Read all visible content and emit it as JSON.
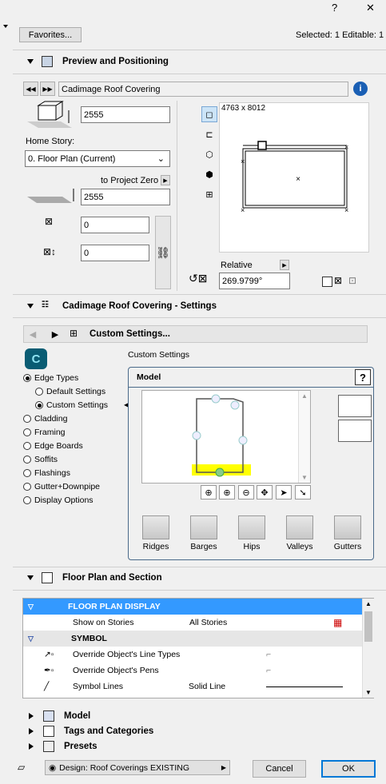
{
  "window": {
    "help_label": "?",
    "close_label": "✕"
  },
  "top": {
    "favorites_label": "Favorites...",
    "selection_status": "Selected: 1 Editable: 1"
  },
  "preview": {
    "header": "Preview and Positioning",
    "object_name": "Cadimage Roof Covering",
    "height_value": "2555",
    "home_story_label": "Home Story:",
    "home_story_value": "0. Floor Plan (Current)",
    "project_zero_label": "to Project Zero",
    "project_zero_value": "2555",
    "x_value": "0",
    "y_value": "0",
    "size_readout": "4763 x 8012",
    "relative_label": "Relative",
    "angle_value": "269.9799°"
  },
  "settings": {
    "header": "Cadimage Roof Covering - Settings",
    "page_title": "Custom Settings...",
    "subtitle": "Custom Settings",
    "nav": [
      {
        "label": "Edge Types",
        "checked": true
      },
      {
        "label": "Default Settings",
        "checked": false
      },
      {
        "label": "Custom Settings",
        "checked": true
      },
      {
        "label": "Cladding",
        "checked": false
      },
      {
        "label": "Framing",
        "checked": false
      },
      {
        "label": "Edge Boards",
        "checked": false
      },
      {
        "label": "Soffits",
        "checked": false
      },
      {
        "label": "Flashings",
        "checked": false
      },
      {
        "label": "Gutter+Downpipe",
        "checked": false
      },
      {
        "label": "Display Options",
        "checked": false
      }
    ],
    "model_title": "Model",
    "help_label": "?",
    "tools": [
      {
        "label": "Ridges"
      },
      {
        "label": "Barges"
      },
      {
        "label": "Hips"
      },
      {
        "label": "Valleys"
      },
      {
        "label": "Gutters"
      }
    ]
  },
  "floorplan": {
    "header": "Floor Plan and Section",
    "rows": [
      {
        "label": "FLOOR PLAN DISPLAY",
        "value": ""
      },
      {
        "label": "Show on Stories",
        "value": "All Stories"
      },
      {
        "label": "SYMBOL",
        "value": ""
      },
      {
        "label": "Override Object's Line Types",
        "value": ""
      },
      {
        "label": "Override Object's Pens",
        "value": ""
      },
      {
        "label": "Symbol Lines",
        "value": "Solid Line"
      }
    ]
  },
  "collapsed_sections": [
    {
      "label": "Model"
    },
    {
      "label": "Tags and Categories"
    },
    {
      "label": "Presets"
    }
  ],
  "footer": {
    "design_label": "Design: Roof Coverings EXISTING",
    "cancel_label": "Cancel",
    "ok_label": "OK"
  },
  "colors": {
    "accent": "#3399ff",
    "highlight": "#ffff00",
    "selection_row": "#3399ff"
  }
}
